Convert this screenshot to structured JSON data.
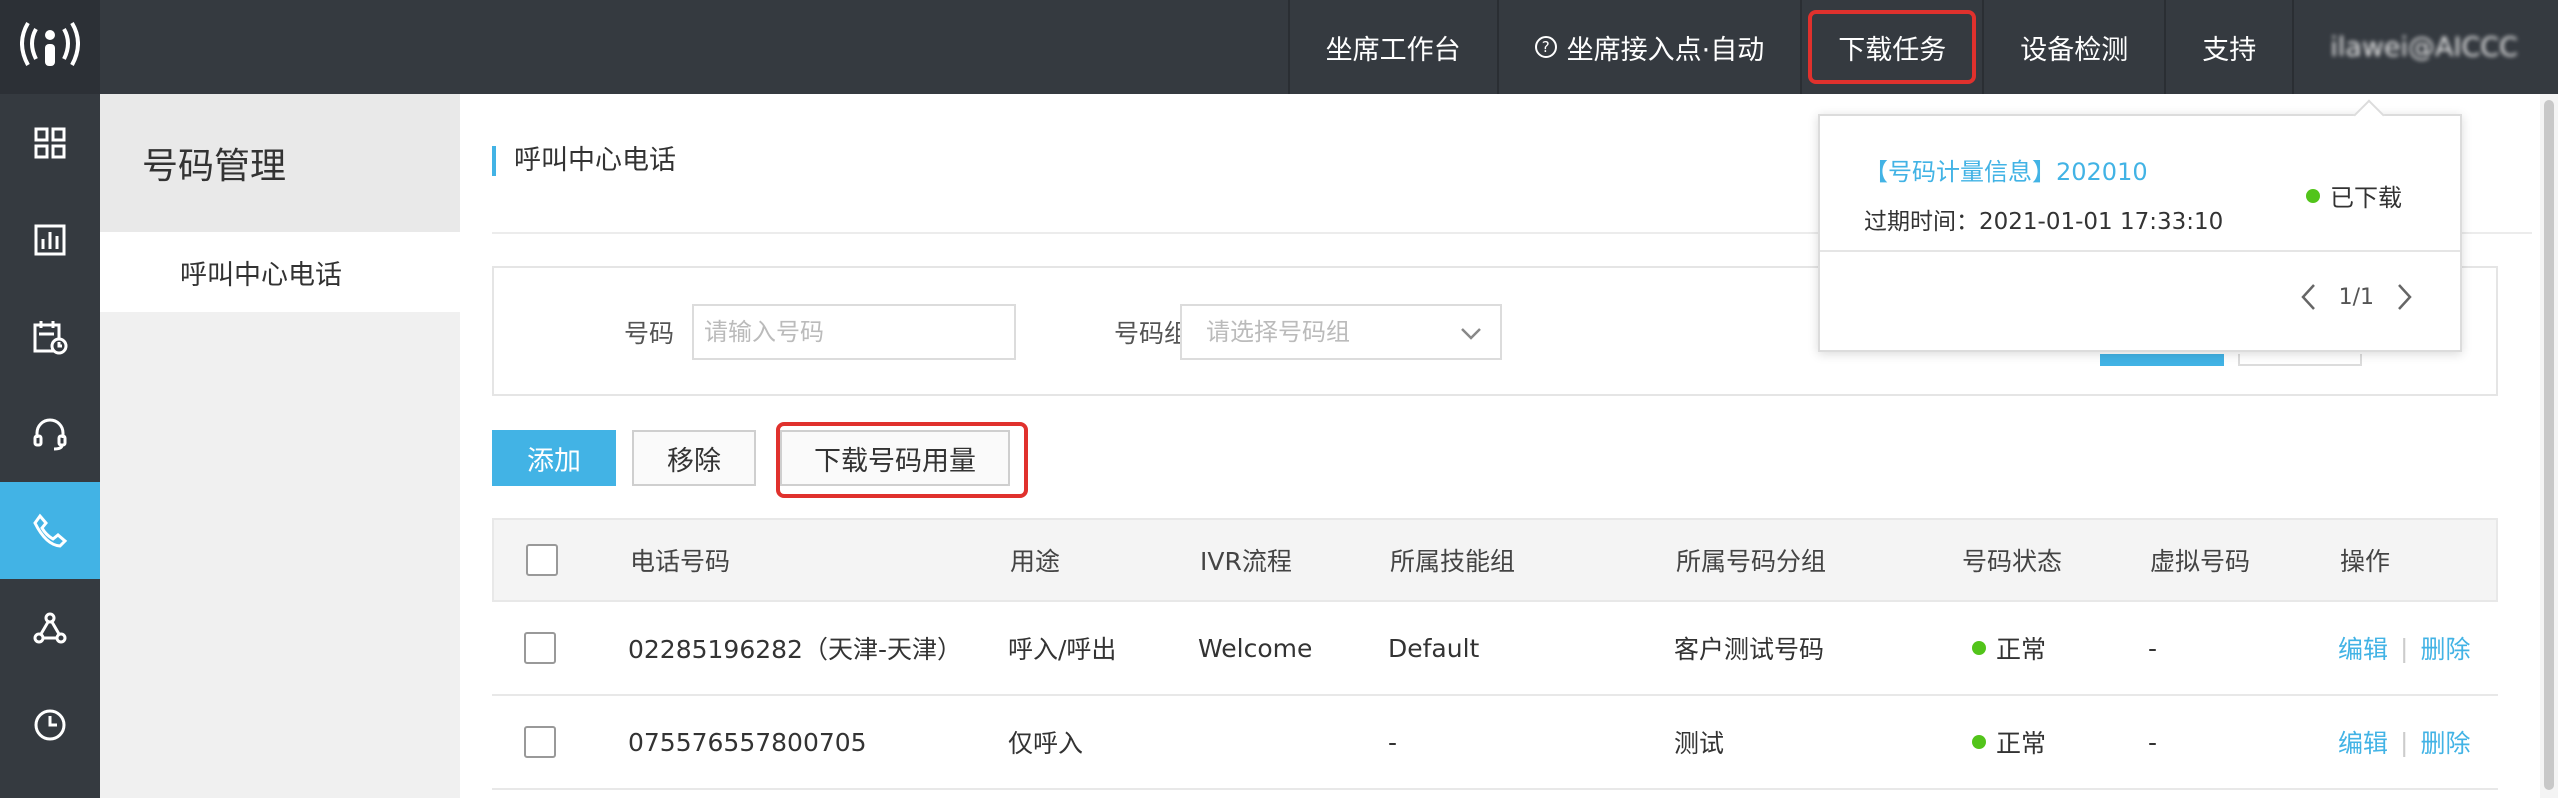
{
  "topnav": {
    "items": [
      "坐席工作台",
      "坐席接入点·自动",
      "下载任务",
      "设备检测",
      "支持"
    ],
    "user": "ilawei@AICCC"
  },
  "sidebar": {
    "icons": [
      "dashboard-icon",
      "report-icon",
      "schedule-icon",
      "headset-icon",
      "phone-icon",
      "flow-icon",
      "history-icon"
    ],
    "active": "phone-icon"
  },
  "subside": {
    "title": "号码管理",
    "items": [
      "呼叫中心电话"
    ]
  },
  "main": {
    "title": "呼叫中心电话",
    "filter": {
      "number_label": "号码",
      "number_placeholder": "请输入号码",
      "group_label": "号码组",
      "group_placeholder": "请选择号码组"
    },
    "actions": {
      "add": "添加",
      "remove": "移除",
      "download": "下载号码用量"
    },
    "table": {
      "headers": [
        "电话号码",
        "用途",
        "IVR流程",
        "所属技能组",
        "所属号码分组",
        "号码状态",
        "虚拟号码",
        "操作"
      ],
      "rows": [
        {
          "number": "02285196282（天津-天津）",
          "usage": "呼入/呼出",
          "ivr": "Welcome",
          "skill": "Default",
          "group": "客户测试号码",
          "status": "正常",
          "virtual": "-",
          "edit": "编辑",
          "delete": "删除"
        },
        {
          "number": "075576557800705",
          "usage": "仅呼入",
          "ivr": "",
          "skill": "-",
          "group": "测试",
          "status": "正常",
          "virtual": "-",
          "edit": "编辑",
          "delete": "删除"
        }
      ]
    }
  },
  "popup": {
    "title": "【号码计量信息】202010",
    "expire": "过期时间：2021-01-01 17:33:10",
    "status": "已下载",
    "page": "1/1"
  },
  "colors": {
    "accent": "#42b3e5",
    "highlight": "#e0312d",
    "status_ok": "#52c41a",
    "topbar": "#353a40"
  }
}
